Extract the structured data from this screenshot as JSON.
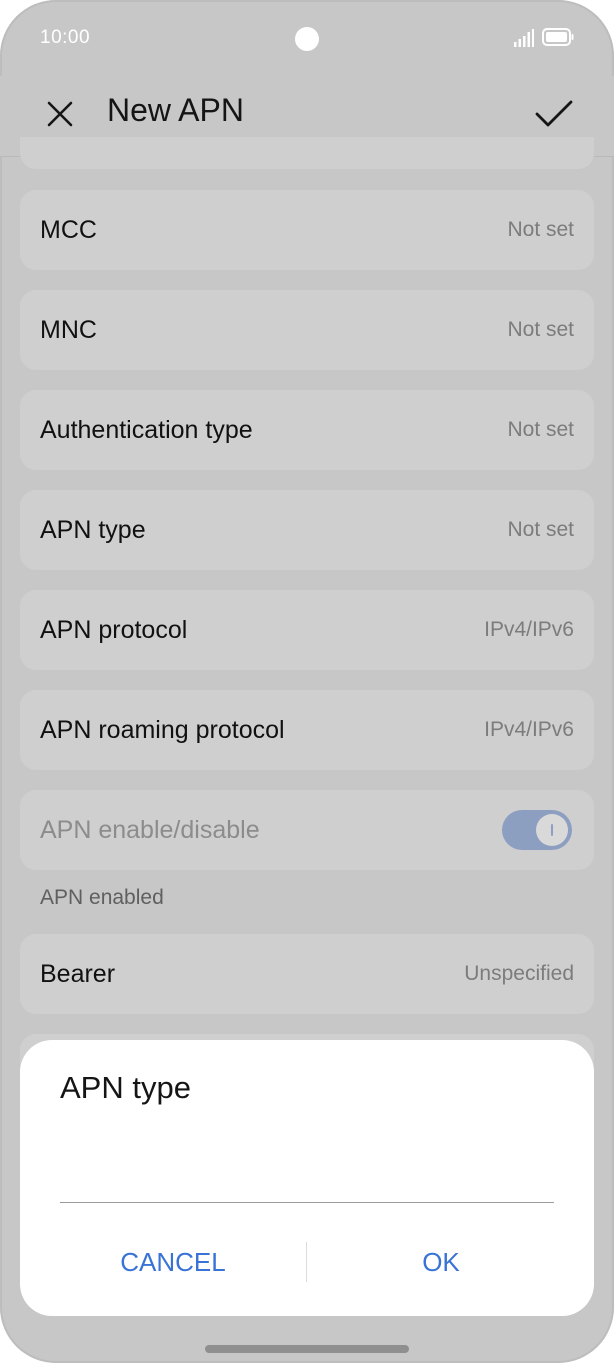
{
  "status_bar": {
    "time": "10:00"
  },
  "app_bar": {
    "title": "New APN",
    "close_icon": "close-icon",
    "confirm_icon": "check-icon"
  },
  "settings": [
    {
      "label": "MCC",
      "value": "Not set"
    },
    {
      "label": "MNC",
      "value": "Not set"
    },
    {
      "label": "Authentication type",
      "value": "Not set"
    },
    {
      "label": "APN type",
      "value": "Not set"
    },
    {
      "label": "APN protocol",
      "value": "IPv4/IPv6"
    },
    {
      "label": "APN roaming protocol",
      "value": "IPv4/IPv6"
    }
  ],
  "apn_toggle": {
    "label": "APN enable/disable",
    "caption": "APN enabled",
    "state": "on",
    "color": "#8d9fc1"
  },
  "bearer": {
    "label": "Bearer",
    "value": "Unspecified"
  },
  "dialog": {
    "title": "APN type",
    "input_value": "",
    "cancel_label": "CANCEL",
    "ok_label": "OK",
    "accent_color": "#3a73d6"
  }
}
